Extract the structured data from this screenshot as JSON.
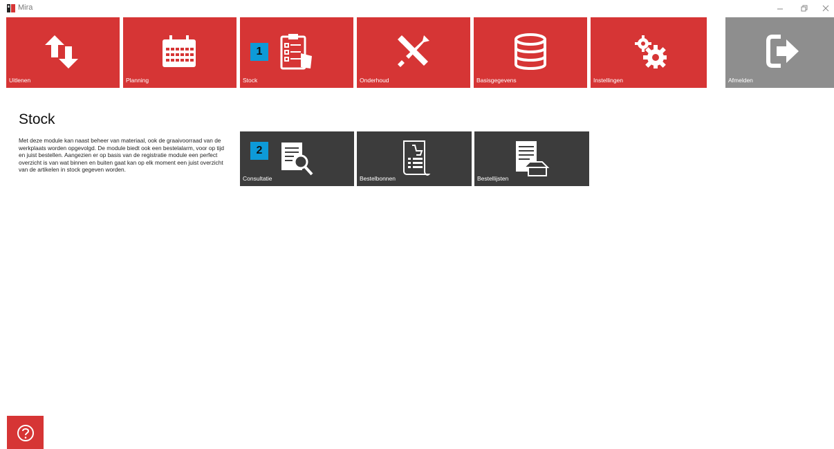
{
  "window": {
    "title": "Mira"
  },
  "nav": {
    "tiles": [
      {
        "label": "Uitlenen",
        "icon": "transfer-arrows-icon"
      },
      {
        "label": "Planning",
        "icon": "calendar-icon"
      },
      {
        "label": "Stock",
        "icon": "clipboard-checklist-icon",
        "badge": "1"
      },
      {
        "label": "Onderhoud",
        "icon": "tools-icon"
      },
      {
        "label": "Basisgegevens",
        "icon": "database-icon"
      },
      {
        "label": "Instellingen",
        "icon": "gears-icon"
      }
    ],
    "logout": {
      "label": "Afmelden",
      "icon": "logout-icon"
    }
  },
  "module": {
    "title": "Stock",
    "description": "Met deze module kan naast beheer van materiaal, ook de graaivoorraad van de werkplaats worden opgevolgd. De module biedt ook een bestelalarm, voor op tijd en juist bestellen. Aangezien er op basis van de registratie module een perfect overzicht is van wat binnen en buiten gaat kan op elk moment een juist overzicht van de artikelen in stock gegeven worden.",
    "subtiles": [
      {
        "label": "Consultatie",
        "icon": "document-search-icon",
        "badge": "2"
      },
      {
        "label": "Bestelbonnen",
        "icon": "order-receipt-icon"
      },
      {
        "label": "Bestellijsten",
        "icon": "order-list-basket-icon"
      }
    ]
  },
  "colors": {
    "accent": "#d63535",
    "subtile": "#3c3c3c",
    "logout": "#8e8e8e",
    "badge": "#0d9ad8"
  },
  "help": {
    "icon": "help-icon"
  }
}
